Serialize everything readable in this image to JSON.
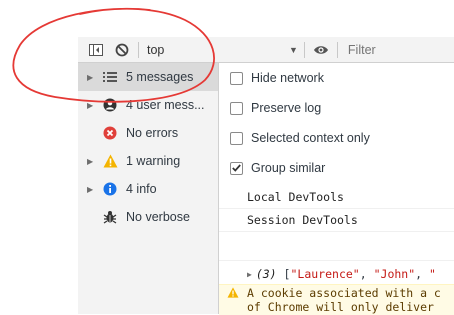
{
  "toolbar": {
    "context": "top",
    "filter_placeholder": "Filter"
  },
  "sidebar": {
    "items": [
      {
        "label": "5 messages",
        "icon": "list-icon"
      },
      {
        "label": "4 user mess...",
        "icon": "user-icon"
      },
      {
        "label": "No errors",
        "icon": "error-icon"
      },
      {
        "label": "1 warning",
        "icon": "warning-icon"
      },
      {
        "label": "4 info",
        "icon": "info-icon"
      },
      {
        "label": "No verbose",
        "icon": "bug-icon"
      }
    ]
  },
  "settings": [
    {
      "label": "Hide network",
      "checked": false
    },
    {
      "label": "Preserve log",
      "checked": false
    },
    {
      "label": "Selected context only",
      "checked": false
    },
    {
      "label": "Group similar",
      "checked": true
    }
  ],
  "console": {
    "messages": [
      "Local DevTools",
      "Session DevTools"
    ],
    "array_count": "(3)",
    "array_open": "[",
    "array_items": [
      "\"Laurence\"",
      "\"John\"",
      "\""
    ],
    "warning_line1": "A cookie associated with a c",
    "warning_line2": "of Chrome will only deliver"
  },
  "colors": {
    "annotation": "#e53935",
    "error": "#e0403a",
    "warning": "#f4b400",
    "info": "#1a73e8"
  }
}
